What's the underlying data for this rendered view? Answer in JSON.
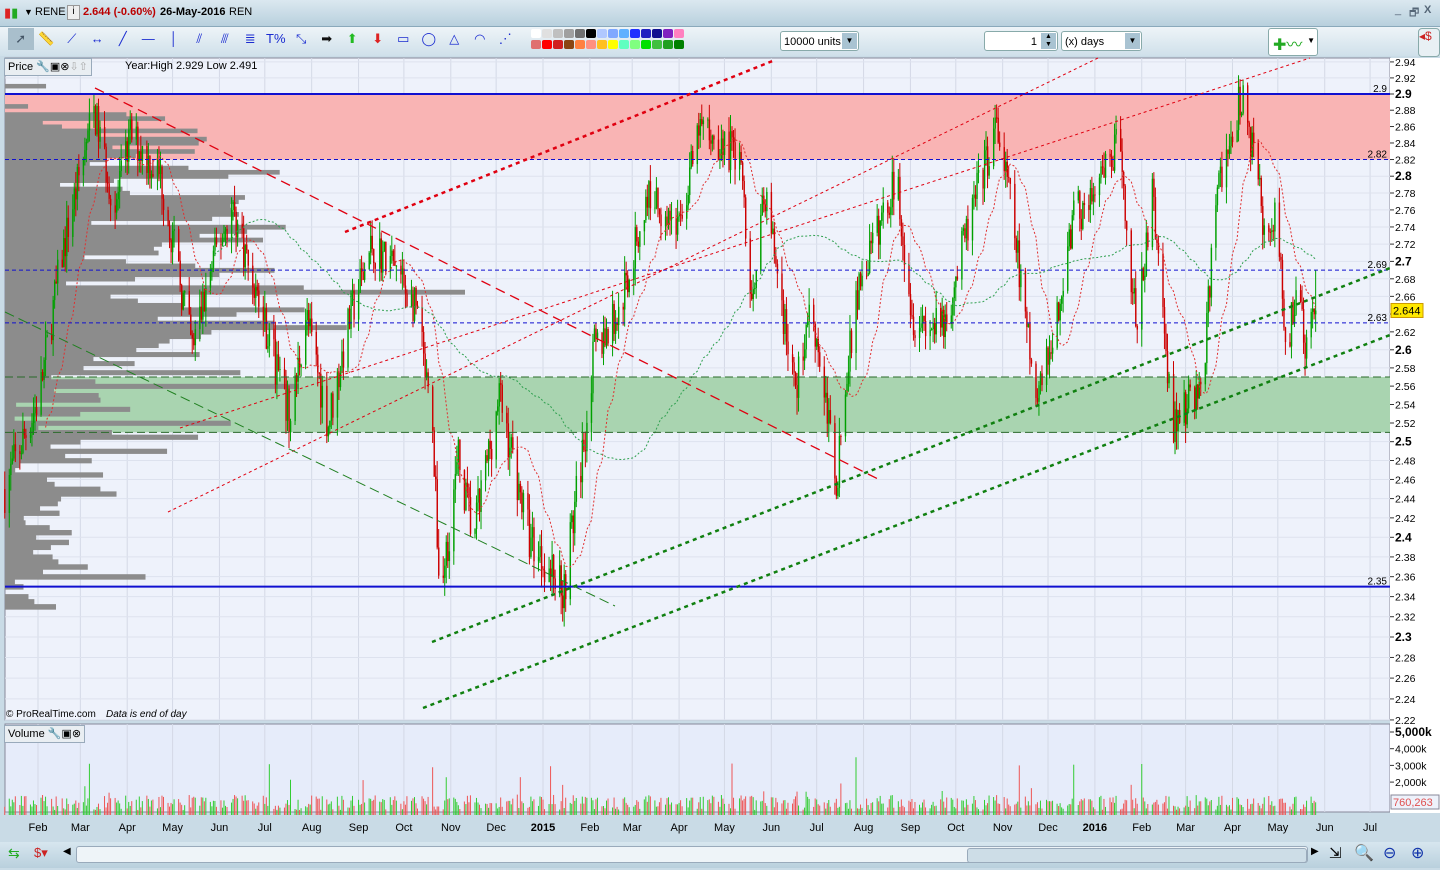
{
  "header": {
    "symbol": "RENE",
    "price_change": "2.644 (-0.60%)",
    "date": "26-May-2016",
    "exchange": "REN",
    "window_controls": [
      "_",
      "🗗",
      "X"
    ]
  },
  "toolbar": {
    "tools": [
      "pointer",
      "ruler",
      "segment",
      "horizontal-measure",
      "line",
      "horizontal-line",
      "vertical-line",
      "channel",
      "parallel-lines",
      "fibonacci",
      "percent",
      "point",
      "arrow-right",
      "arrow-up-green",
      "arrow-down-red",
      "rectangle",
      "ellipse",
      "triangle",
      "fan",
      "gann"
    ],
    "percent_label": "T%",
    "units_select": "10000 units",
    "period_value": "1",
    "period_unit": "(x) days"
  },
  "colors_top": [
    "#ffffff",
    "#e0e0e0",
    "#c0c0c0",
    "#a0a0a0",
    "#707070",
    "#000000",
    "#b0c8ff",
    "#80a8ff",
    "#60b0ff",
    "#2030ff",
    "#2020c0",
    "#101090",
    "#8020c0",
    "#ff80c0"
  ],
  "colors_bottom": [
    "#e07070",
    "#ff0000",
    "#d02020",
    "#8b4513",
    "#ff8040",
    "#ff9080",
    "#ffc020",
    "#ffff00",
    "#60ffc0",
    "#80ff80",
    "#00e000",
    "#40c040",
    "#20a020",
    "#008000"
  ],
  "price_panel": {
    "label": "Price",
    "info": "Year:High 2.929 Low 2.491",
    "current": "2.644",
    "credit": "© ProRealTime.com",
    "credit_note": "Data is end of day",
    "y_ticks": [
      "2.94",
      "2.92",
      "2.9",
      "2.88",
      "2.86",
      "2.84",
      "2.82",
      "2.8",
      "2.78",
      "2.76",
      "2.74",
      "2.72",
      "2.7",
      "2.68",
      "2.66",
      "2.64",
      "2.62",
      "2.6",
      "2.58",
      "2.56",
      "2.54",
      "2.52",
      "2.5",
      "2.48",
      "2.46",
      "2.44",
      "2.42",
      "2.4",
      "2.38",
      "2.36",
      "2.34",
      "2.32",
      "2.3",
      "2.28",
      "2.26",
      "2.24",
      "2.22"
    ],
    "levels": [
      {
        "value": "2.9",
        "style": "solid"
      },
      {
        "value": "2.82",
        "style": "dashed"
      },
      {
        "value": "2.69",
        "style": "dashed"
      },
      {
        "value": "2.63",
        "style": "dashed"
      },
      {
        "value": "2.35",
        "style": "solid"
      }
    ],
    "resistance_zone": [
      2.82,
      2.9
    ],
    "support_zone": [
      2.51,
      2.57
    ]
  },
  "volume_panel": {
    "label": "Volume",
    "y_ticks": [
      "5,000k",
      "4,000k",
      "3,000k",
      "2,000k"
    ],
    "current": "760,263"
  },
  "x_ticks": [
    [
      "2014-02-01",
      "Feb"
    ],
    [
      "2014-03-01",
      "Mar"
    ],
    [
      "2014-04-01",
      "Apr"
    ],
    [
      "2014-05-01",
      "May"
    ],
    [
      "2014-06-01",
      "Jun"
    ],
    [
      "2014-07-01",
      "Jul"
    ],
    [
      "2014-08-01",
      "Aug"
    ],
    [
      "2014-09-01",
      "Sep"
    ],
    [
      "2014-10-01",
      "Oct"
    ],
    [
      "2014-11-01",
      "Nov"
    ],
    [
      "2014-12-01",
      "Dec"
    ],
    [
      "2015-01-01",
      "2015"
    ],
    [
      "2015-02-01",
      "Feb"
    ],
    [
      "2015-03-01",
      "Mar"
    ],
    [
      "2015-04-01",
      "Apr"
    ],
    [
      "2015-05-01",
      "May"
    ],
    [
      "2015-06-01",
      "Jun"
    ],
    [
      "2015-07-01",
      "Jul"
    ],
    [
      "2015-08-01",
      "Aug"
    ],
    [
      "2015-09-01",
      "Sep"
    ],
    [
      "2015-10-01",
      "Oct"
    ],
    [
      "2015-11-01",
      "Nov"
    ],
    [
      "2015-12-01",
      "Dec"
    ],
    [
      "2016-01-01",
      "2016"
    ],
    [
      "2016-02-01",
      "Feb"
    ],
    [
      "2016-03-01",
      "Mar"
    ],
    [
      "2016-04-01",
      "Apr"
    ],
    [
      "2016-05-01",
      "May"
    ],
    [
      "2016-06-01",
      "Jun"
    ],
    [
      "2016-07-01",
      "Jul"
    ]
  ],
  "chart_data": {
    "type": "candlestick",
    "approx_price_path": [
      [
        "2014-01-10",
        2.45
      ],
      [
        "2014-02-02",
        2.55
      ],
      [
        "2014-02-16",
        2.7
      ],
      [
        "2014-03-10",
        2.88
      ],
      [
        "2014-03-24",
        2.76
      ],
      [
        "2014-04-03",
        2.85
      ],
      [
        "2014-04-23",
        2.8
      ],
      [
        "2014-05-14",
        2.6
      ],
      [
        "2014-05-31",
        2.72
      ],
      [
        "2014-06-10",
        2.76
      ],
      [
        "2014-07-01",
        2.63
      ],
      [
        "2014-07-18",
        2.52
      ],
      [
        "2014-07-28",
        2.64
      ],
      [
        "2014-08-12",
        2.52
      ],
      [
        "2014-08-27",
        2.64
      ],
      [
        "2014-09-10",
        2.72
      ],
      [
        "2014-09-26",
        2.69
      ],
      [
        "2014-10-10",
        2.64
      ],
      [
        "2014-10-20",
        2.5
      ],
      [
        "2014-10-25",
        2.34
      ],
      [
        "2014-11-06",
        2.48
      ],
      [
        "2014-11-16",
        2.4
      ],
      [
        "2014-12-03",
        2.55
      ],
      [
        "2014-12-23",
        2.4
      ],
      [
        "2015-01-15",
        2.35
      ],
      [
        "2015-01-28",
        2.5
      ],
      [
        "2015-02-04",
        2.6
      ],
      [
        "2015-02-20",
        2.64
      ],
      [
        "2015-03-12",
        2.78
      ],
      [
        "2015-04-01",
        2.74
      ],
      [
        "2015-04-15",
        2.86
      ],
      [
        "2015-05-12",
        2.82
      ],
      [
        "2015-05-18",
        2.65
      ],
      [
        "2015-05-28",
        2.78
      ],
      [
        "2015-06-17",
        2.55
      ],
      [
        "2015-06-27",
        2.66
      ],
      [
        "2015-07-14",
        2.46
      ],
      [
        "2015-07-27",
        2.66
      ],
      [
        "2015-08-23",
        2.8
      ],
      [
        "2015-09-02",
        2.64
      ],
      [
        "2015-09-22",
        2.62
      ],
      [
        "2015-10-15",
        2.78
      ],
      [
        "2015-10-28",
        2.86
      ],
      [
        "2015-11-07",
        2.76
      ],
      [
        "2015-11-20",
        2.58
      ],
      [
        "2015-11-24",
        2.54
      ],
      [
        "2015-12-07",
        2.63
      ],
      [
        "2015-12-17",
        2.75
      ],
      [
        "2016-01-03",
        2.78
      ],
      [
        "2016-01-16",
        2.84
      ],
      [
        "2016-01-29",
        2.62
      ],
      [
        "2016-02-08",
        2.78
      ],
      [
        "2016-02-21",
        2.52
      ],
      [
        "2016-03-12",
        2.56
      ],
      [
        "2016-03-22",
        2.78
      ],
      [
        "2016-04-07",
        2.9
      ],
      [
        "2016-04-17",
        2.8
      ],
      [
        "2016-04-24",
        2.72
      ],
      [
        "2016-04-30",
        2.75
      ],
      [
        "2016-05-07",
        2.6
      ],
      [
        "2016-05-14",
        2.68
      ],
      [
        "2016-05-19",
        2.6
      ],
      [
        "2016-05-26",
        2.644
      ]
    ],
    "scale": "log",
    "up_color": "#00a000",
    "down_color": "#cc0000"
  }
}
